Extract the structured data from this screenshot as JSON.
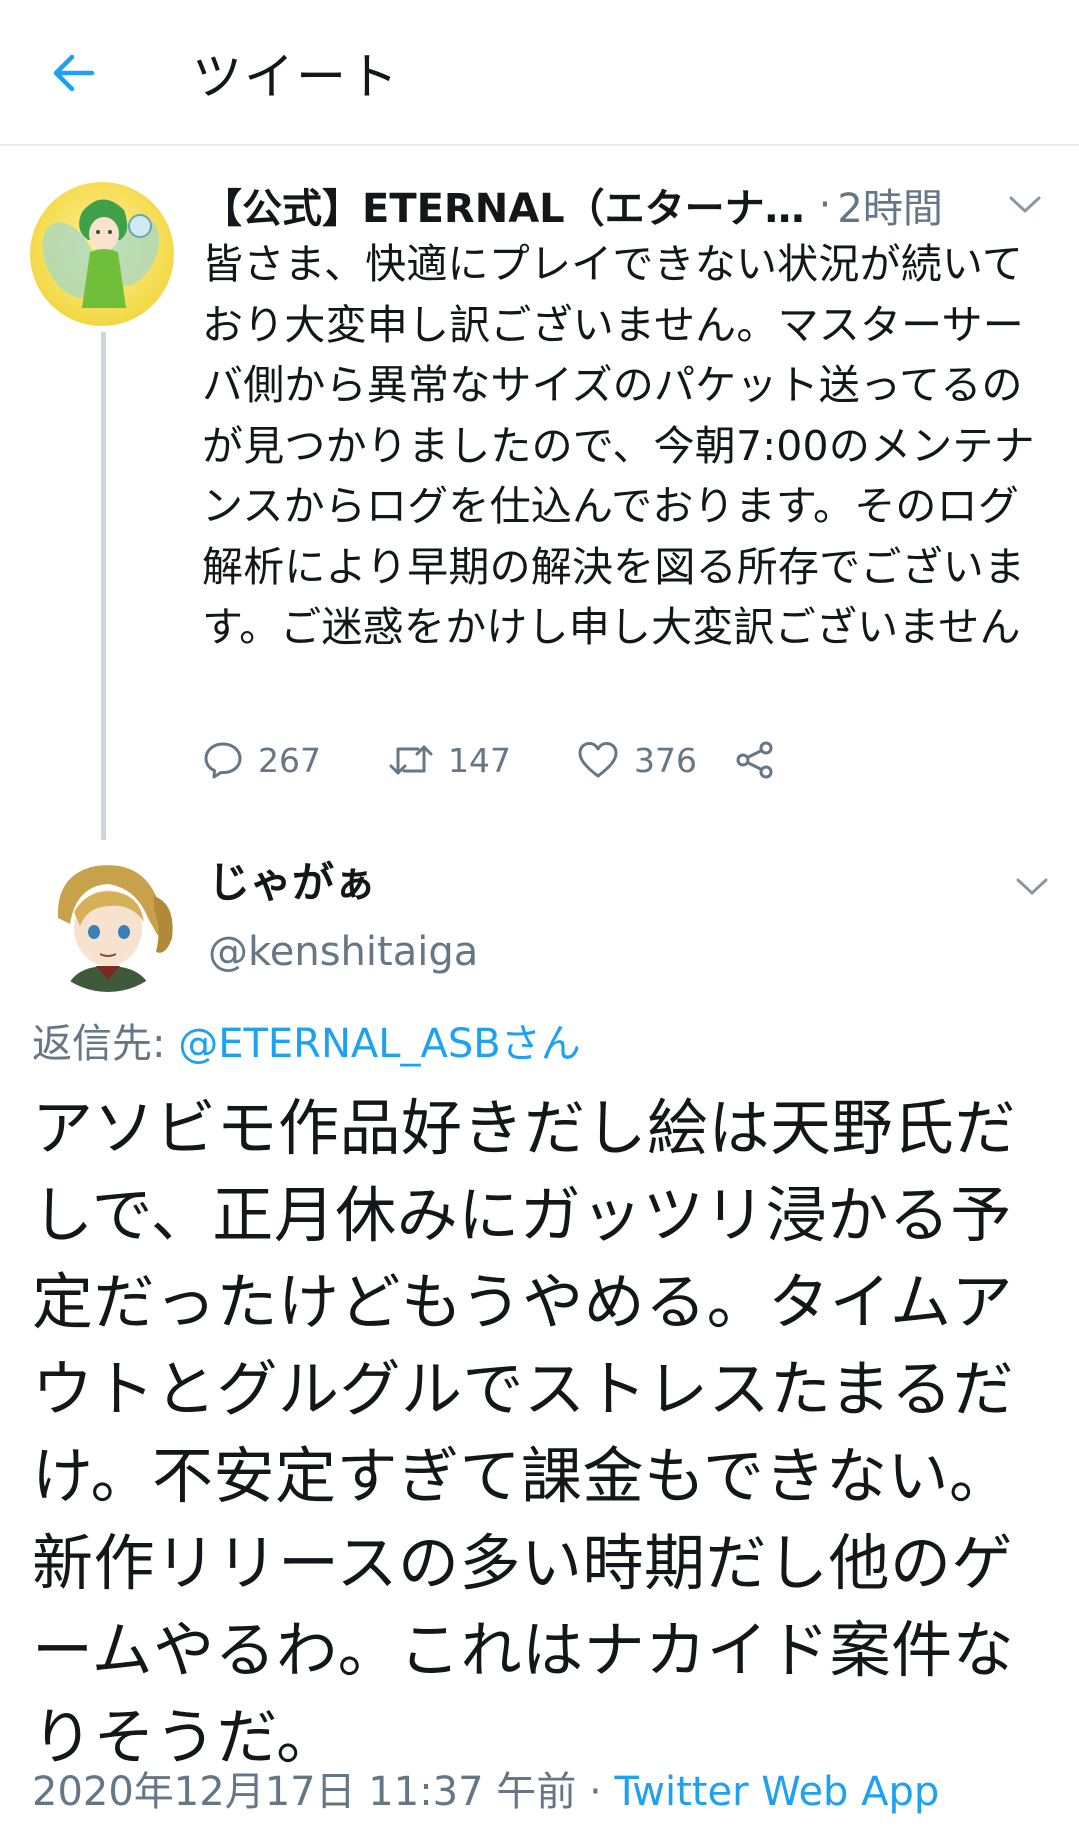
{
  "header": {
    "title": "ツイート"
  },
  "parent_tweet": {
    "display_name": "【公式】ETERNAL（エターナ…",
    "separator": "·",
    "time": "2時間",
    "text": "皆さま、快適にプレイできない状況が続いており大変申し訳ございません。マスターサーバ側から異常なサイズのパケット送ってるのが見つかりましたので、今朝7:00のメンテナンスからログを仕込んでおります。そのログ解析により早期の解決を図る所存でございます。ご迷惑をかけし申し大変訳ございません",
    "replies": "267",
    "retweets": "147",
    "likes": "376"
  },
  "reply_tweet": {
    "display_name": "じゃがぁ",
    "handle": "@kenshitaiga",
    "reply_to_label": "返信先: ",
    "reply_to_mention": "@ETERNAL_ASBさん",
    "text": "アソビモ作品好きだし絵は天野氏だしで、正月休みにガッツリ浸かる予定だったけどもうやめる。タイムアウトとグルグルでストレスたまるだけ。不安定すぎて課金もできない。新作リリースの多い時期だし他のゲームやるわ。これはナカイド案件なりそうだ。",
    "timestamp": "2020年12月17日 11:37 午前",
    "meta_separator": " · ",
    "source": "Twitter Web App"
  },
  "colors": {
    "accent": "#1da1f2",
    "secondary_text": "#657786",
    "primary_text": "#14171a",
    "divider": "#e6ecf0"
  },
  "icons": {
    "back": "arrow-left-icon",
    "caret": "chevron-down-icon",
    "reply": "reply-icon",
    "retweet": "retweet-icon",
    "like": "heart-icon",
    "share": "share-icon"
  }
}
